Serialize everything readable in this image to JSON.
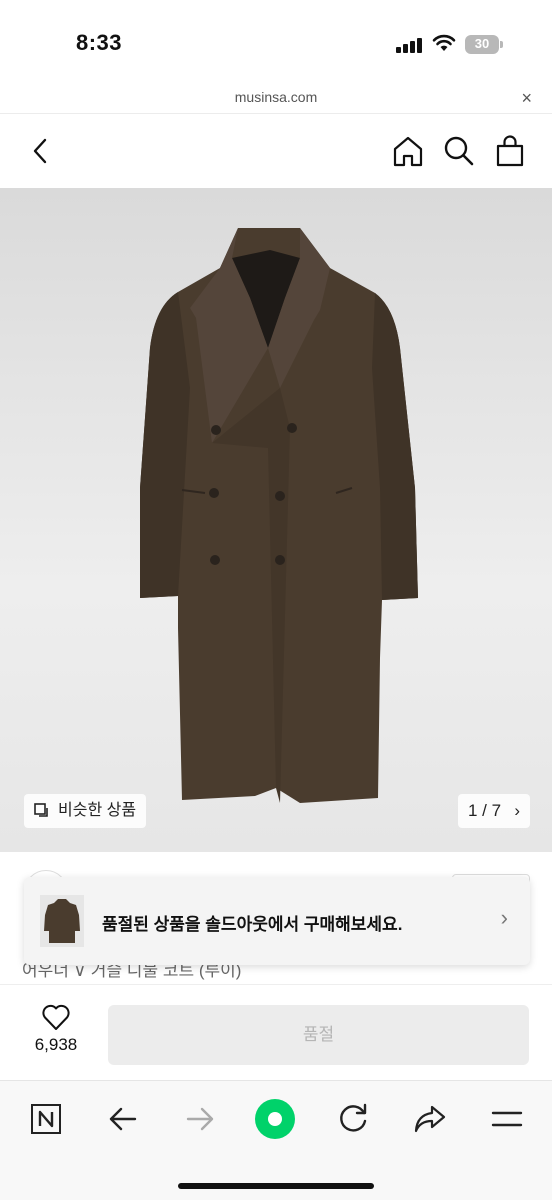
{
  "status_bar": {
    "time": "8:33",
    "battery": "30"
  },
  "browser": {
    "url": "musinsa.com",
    "close_label": "×"
  },
  "header": {
    "back_icon": "chevron-left-icon",
    "home_icon": "home-icon",
    "search_icon": "search-icon",
    "cart_icon": "shopping-bag-icon"
  },
  "gallery": {
    "similar_label": "비슷한 상품",
    "current_page": "1",
    "total_pages": "7",
    "page_label": "1 / 7",
    "chevron": "›",
    "coat_color": "#4a3c2e"
  },
  "product": {
    "name_partial": "어우너 ∨ 거슬 디물 코트 (루이)"
  },
  "soldout_banner": {
    "text": "품절된 상품을 솔드아웃에서 구매해보세요.",
    "chevron": "›"
  },
  "action_bar": {
    "like_count": "6,938",
    "buy_label": "품절"
  },
  "colors": {
    "accent_green": "#00d26a",
    "disabled_bg": "#ececec",
    "disabled_text": "#b5b5b5"
  }
}
